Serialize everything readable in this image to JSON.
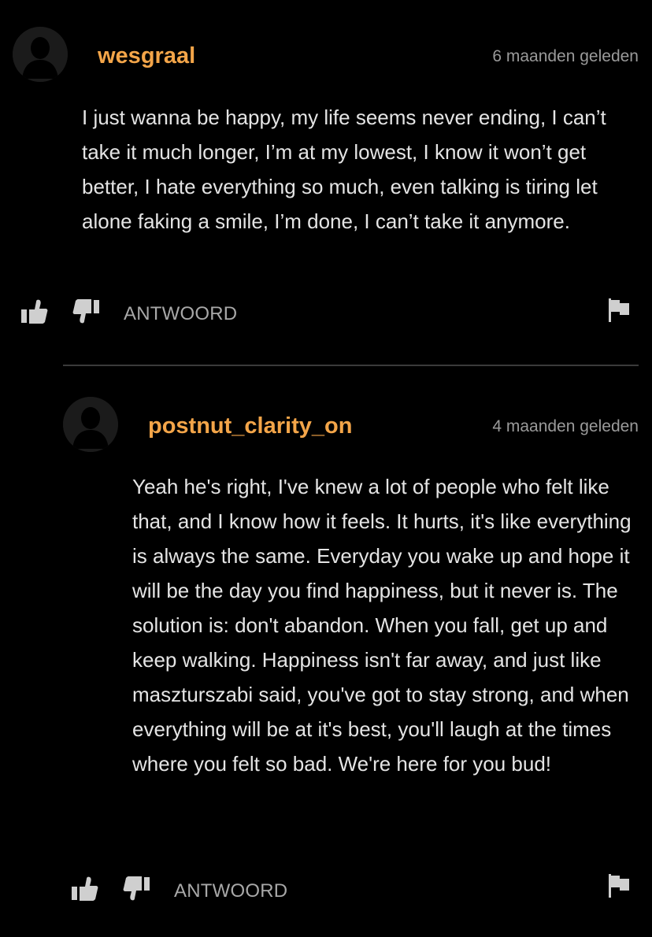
{
  "comments": [
    {
      "username": "wesgraal",
      "time": "6 maanden geleden",
      "body": "I just wanna be happy, my life seems never ending, I can’t take it much longer, I’m at my lowest, I know it won’t get better, I hate everything so much, even talking is tiring let alone faking a smile, I’m done, I can’t take it anymore.",
      "reply_label": "ANTWOORD",
      "icons": [
        "avatar-placeholder-icon",
        "thumbs-up-icon",
        "thumbs-down-icon",
        "flag-icon"
      ]
    },
    {
      "username": "postnut_clarity_on",
      "time": "4 maanden geleden",
      "body": "Yeah he's right, I've knew a lot of people who felt like that, and I know how it feels. It hurts, it's like everything is always the same. Everyday you wake up and hope it will be the day you find happiness, but it never is. The solution is: don't abandon. When you fall, get up and keep walking. Happiness isn't far away, and just like maszturszabi said, you've got to stay strong, and when everything will be at it's best, you'll laugh at the times where you felt so bad. We're here for you bud!",
      "reply_label": "ANTWOORD",
      "icons": [
        "avatar-placeholder-icon",
        "thumbs-up-icon",
        "thumbs-down-icon",
        "flag-icon"
      ]
    }
  ],
  "colors": {
    "background": "#000000",
    "username": "#f3a549",
    "body_text": "#e4e4e4",
    "meta_text": "#9a9a9a",
    "icon": "#cfcfcf",
    "divider": "#3a3a3a"
  }
}
